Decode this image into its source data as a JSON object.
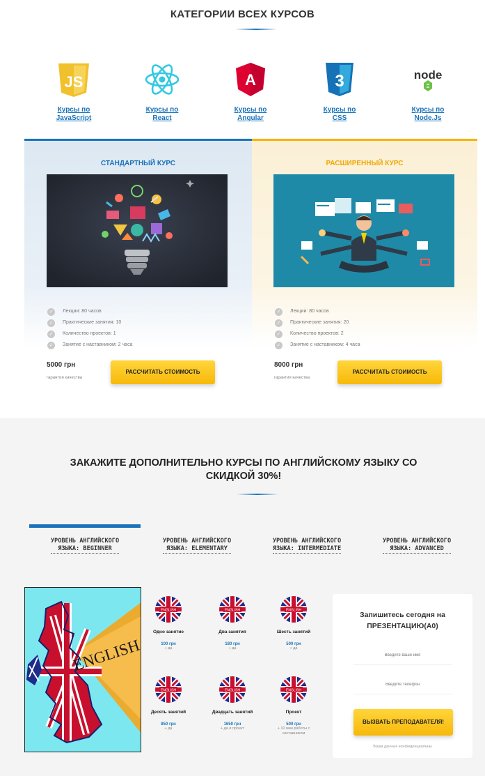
{
  "categories": {
    "title": "КАТЕГОРИИ ВСЕХ КУРСОВ",
    "items": [
      {
        "icon": "javascript-icon",
        "label": "Курсы по JavaScript",
        "line1": "Курсы по",
        "line2": "JavaScript"
      },
      {
        "icon": "react-icon",
        "label": "Курсы по React",
        "line1": "Курсы по",
        "line2": "React"
      },
      {
        "icon": "angular-icon",
        "label": "Курсы по Angular",
        "line1": "Курсы по",
        "line2": "Angular"
      },
      {
        "icon": "css-icon",
        "label": "Курсы по CSS",
        "line1": "Курсы по",
        "line2": "CSS"
      },
      {
        "icon": "nodejs-icon",
        "label": "Курсы по Node.Js",
        "line1": "Курсы по",
        "line2": "Node.Js"
      }
    ],
    "icon_texts": {
      "js": "JS",
      "angular": "A",
      "css": "3",
      "node": "node"
    }
  },
  "plans": {
    "standard": {
      "name": "СТАНДАРТНЫЙ КУРС",
      "features": [
        "Лекции: 80 часов",
        "Практические занятия: 10",
        "Количество проектов: 1",
        "Занятие с наставником: 2 часа"
      ],
      "price": "5000 грн",
      "guarantee": "гарантия качества",
      "button": "РАССЧИТАТЬ СТОИМОСТЬ",
      "accent": "#1a73ba"
    },
    "advanced": {
      "name": "РАСШИРЕННЫЙ КУРС",
      "features": [
        "Лекции: 80 часов",
        "Практические занятия: 20",
        "Количество проектов: 2",
        "Занятие с наставником: 4 часа"
      ],
      "price": "8000 грн",
      "guarantee": "гарантия качества",
      "button": "РАССЧИТАТЬ СТОИМОСТЬ",
      "accent": "#f5b400"
    }
  },
  "english": {
    "title_line1": "ЗАКАЖИТЕ ДОПОЛНИТЕЛЬНО КУРСЫ ПО АНГЛИЙСКОМУ ЯЗЫКУ СО",
    "title_line2": "СКИДКОЙ 30%!",
    "tabs": [
      {
        "line1": "УРОВЕНЬ АНГЛИЙСКОГО",
        "line2": "ЯЗЫКА: BEGINNER",
        "active": true
      },
      {
        "line1": "УРОВЕНЬ АНГЛИЙСКОГО",
        "line2": "ЯЗЫКА: ELEMENTARY",
        "active": false
      },
      {
        "line1": "УРОВЕНЬ АНГЛИЙСКОГО",
        "line2": "ЯЗЫКА: INTERMEDIATE",
        "active": false
      },
      {
        "line1": "УРОВЕНЬ АНГЛИЙСКОГО",
        "line2": "ЯЗЫКА: ADVANCED",
        "active": false
      }
    ],
    "map_text": "ENGLISH",
    "flag_text": "ENGLISH",
    "lessons": [
      {
        "name": "Одно занятие",
        "price": "100 грн",
        "note": "+ да"
      },
      {
        "name": "Два занятия",
        "price": "180 грн",
        "note": "+ да"
      },
      {
        "name": "Шесть занятий",
        "price": "500 грн",
        "note": "+ да"
      },
      {
        "name": "Десять занятий",
        "price": "850 грн",
        "note": "+ да"
      },
      {
        "name": "Двадцать занятий",
        "price": "1650 грн",
        "note": "+ да и проект"
      },
      {
        "name": "Проект",
        "price": "500 грн",
        "note": "+ 10 мин работы с наставником"
      }
    ]
  },
  "form": {
    "title_line1": "Запишитесь сегодня на",
    "title_line2": "ПРЕЗЕНТАЦИЮ(А0)",
    "name_placeholder": "Введите ваше имя",
    "phone_placeholder": "Введите телефон",
    "button": "ВЫЗВАТЬ ПРЕПОДАВАТЕЛЯ!",
    "privacy": "Ваши данные конфиденциальны"
  }
}
